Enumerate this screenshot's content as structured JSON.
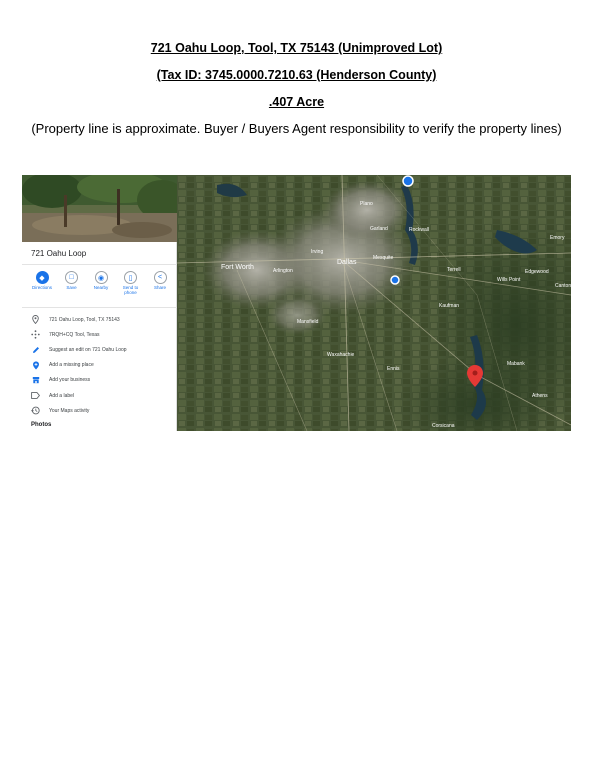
{
  "document": {
    "title_line1": "721 Oahu Loop, Tool, TX 75143 (Unimproved Lot)",
    "title_line2": "(Tax ID: 3745.0000.7210.63 (Henderson County)",
    "title_line3": ".407 Acre",
    "note": "(Property line is approximate. Buyer / Buyers Agent responsibility to verify the property lines)"
  },
  "maps_panel": {
    "place_name": "721 Oahu Loop",
    "actions": [
      {
        "label": "Directions",
        "icon": "directions-icon"
      },
      {
        "label": "Save",
        "icon": "bookmark-icon"
      },
      {
        "label": "Nearby",
        "icon": "nearby-icon"
      },
      {
        "label": "Send to phone",
        "icon": "phone-icon"
      },
      {
        "label": "Share",
        "icon": "share-icon"
      }
    ],
    "rows": [
      {
        "text": "721 Oahu Loop, Tool, TX 75143",
        "icon": "location-pin-icon"
      },
      {
        "text": "7RQH+CQ Tool, Texas",
        "icon": "plus-code-icon"
      },
      {
        "text": "Suggest an edit on 721 Oahu Loop",
        "icon": "pencil-icon"
      },
      {
        "text": "Add a missing place",
        "icon": "add-place-icon"
      },
      {
        "text": "Add your business",
        "icon": "storefront-icon"
      },
      {
        "text": "Add a label",
        "icon": "label-icon"
      },
      {
        "text": "Your Maps activity",
        "icon": "history-icon"
      }
    ],
    "photos_label": "Photos",
    "accent_color": "#1a73e8"
  },
  "map": {
    "labels": [
      "Plano",
      "Garland",
      "Irving",
      "Fort Worth",
      "Arlington",
      "Dallas",
      "Rockwall",
      "Mesquite",
      "Wills Point",
      "Mansfield",
      "Waxahachie",
      "Ennis",
      "Kaufman",
      "Corsicana",
      "Mabank",
      "Athens",
      "Terrell",
      "Emory",
      "Edgewood",
      "Canton"
    ],
    "marker_color": "#e53935"
  }
}
